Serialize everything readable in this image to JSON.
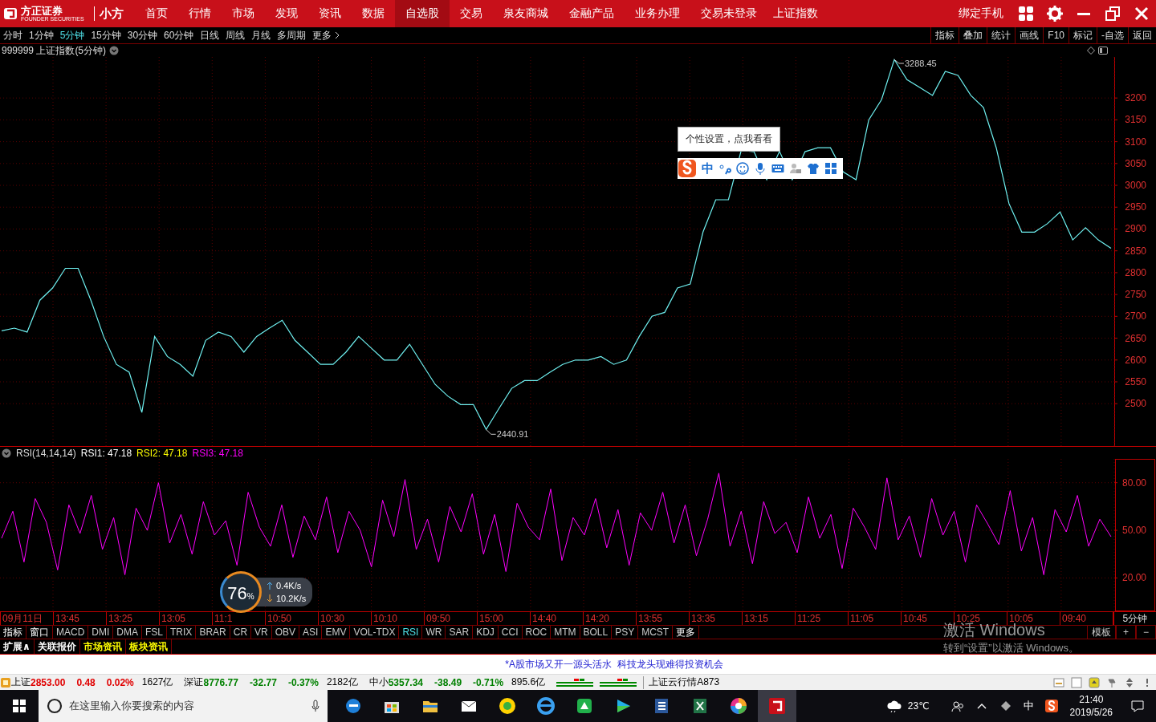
{
  "app_bar": {
    "logo": "方正证券",
    "logo_sub": "FOUNDER SECURITIES",
    "product": "小方",
    "nav": [
      {
        "label": "首页",
        "selected": false
      },
      {
        "label": "行情",
        "selected": false
      },
      {
        "label": "市场",
        "selected": false
      },
      {
        "label": "发现",
        "selected": false
      },
      {
        "label": "资讯",
        "selected": false
      },
      {
        "label": "数据",
        "selected": false
      },
      {
        "label": "自选股",
        "selected": true
      },
      {
        "label": "交易",
        "selected": false
      },
      {
        "label": "泉友商城",
        "selected": false
      },
      {
        "label": "金融产品",
        "selected": false
      },
      {
        "label": "业务办理",
        "selected": false
      }
    ],
    "trade_status": "交易未登录",
    "index_name": "上证指数",
    "bind_phone": "绑定手机"
  },
  "periods": [
    {
      "label": "分时",
      "selected": false
    },
    {
      "label": "1分钟",
      "selected": false
    },
    {
      "label": "5分钟",
      "selected": true
    },
    {
      "label": "15分钟",
      "selected": false
    },
    {
      "label": "30分钟",
      "selected": false
    },
    {
      "label": "60分钟",
      "selected": false
    },
    {
      "label": "日线",
      "selected": false
    },
    {
      "label": "周线",
      "selected": false
    },
    {
      "label": "月线",
      "selected": false
    },
    {
      "label": "多周期",
      "selected": false
    },
    {
      "label": "更多",
      "selected": false
    }
  ],
  "chart_tools": [
    "指标",
    "叠加",
    "统计",
    "画线",
    "F10",
    "标记",
    "-自选",
    "返回"
  ],
  "price_pane": {
    "title": "999999 上证指数(5分钟)",
    "chart_data": {
      "type": "line",
      "grid": true,
      "ylim": [
        2403,
        3294
      ],
      "yticks": [
        2500,
        2550,
        2600,
        2650,
        2700,
        2750,
        2800,
        2850,
        2900,
        2950,
        3000,
        3050,
        3100,
        3150,
        3200
      ],
      "series": [
        {
          "color": "#6ff0f0",
          "values": [
            2667,
            2673,
            2664,
            2737,
            2765,
            2810,
            2810,
            2737,
            2654,
            2590,
            2572,
            2480,
            2654,
            2608,
            2590,
            2563,
            2645,
            2664,
            2654,
            2618,
            2654,
            2673,
            2691,
            2645,
            2618,
            2590,
            2590,
            2618,
            2654,
            2627,
            2600,
            2600,
            2636,
            2590,
            2544,
            2517,
            2498,
            2498,
            2441,
            2489,
            2535,
            2553,
            2553,
            2572,
            2590,
            2600,
            2600,
            2608,
            2590,
            2600,
            2654,
            2700,
            2709,
            2765,
            2774,
            2893,
            2967,
            2967,
            3080,
            3077,
            3013,
            3078,
            3013,
            3077,
            3086,
            3086,
            3031,
            3013,
            3150,
            3196,
            3288,
            3242,
            3224,
            3206,
            3261,
            3252,
            3206,
            3178,
            3086,
            2958,
            2893,
            2893,
            2912,
            2939,
            2875,
            2903,
            2875,
            2856
          ]
        }
      ],
      "annotations": [
        "3288.45",
        "2440.91"
      ]
    }
  },
  "ime": {
    "tooltip": "个性设置，点我看看",
    "mode": "中"
  },
  "rsi_pane": {
    "title": "RSI(14,14,14)",
    "legend": [
      {
        "label": "RSI1: 47.18",
        "color": "#ffffff"
      },
      {
        "label": "RSI2: 47.18",
        "color": "#ffff00"
      },
      {
        "label": "RSI3: 47.18",
        "color": "#ff00ff"
      }
    ],
    "chart_data": {
      "type": "line",
      "grid": true,
      "ylim": [
        -1,
        95
      ],
      "yticks": [
        {
          "value": 20,
          "label": "20.00"
        },
        {
          "value": 50,
          "label": "50.00"
        },
        {
          "value": 80,
          "label": "80.00"
        }
      ],
      "series": [
        {
          "color": "#ff00ff",
          "values": [
            45,
            62,
            30,
            70,
            55,
            25,
            66,
            48,
            72,
            38,
            58,
            22,
            64,
            50,
            80,
            42,
            60,
            35,
            68,
            47,
            56,
            28,
            74,
            52,
            40,
            66,
            33,
            59,
            44,
            71,
            36,
            62,
            50,
            27,
            69,
            46,
            82,
            38,
            57,
            30,
            65,
            49,
            73,
            35,
            60,
            24,
            67,
            52,
            44,
            76,
            31,
            58,
            47,
            70,
            39,
            63,
            28,
            61,
            50,
            74,
            42,
            66,
            34,
            57,
            86,
            40,
            62,
            29,
            68,
            48,
            55,
            36,
            71,
            45,
            60,
            26,
            64,
            52,
            38,
            83,
            44,
            59,
            33,
            70,
            47,
            62,
            30,
            66,
            54,
            41,
            75,
            37,
            58,
            22,
            63,
            49,
            72,
            40,
            57,
            46
          ]
        }
      ]
    }
  },
  "speed_widget": {
    "percent": "76",
    "unit": "%",
    "upload": "0.4K/s",
    "download": "10.2K/s"
  },
  "time_axis": {
    "labels": [
      "09月11日",
      "13:45",
      "13:25",
      "13:05",
      "11:1",
      "10:50",
      "10:30",
      "10:10",
      "09:50",
      "15:00",
      "14:40",
      "14:20",
      "13:55",
      "13:35",
      "13:15",
      "11:25",
      "11:05",
      "10:45",
      "10:25",
      "10:05",
      "09:40"
    ],
    "period": "5分钟"
  },
  "indicator_tabs": [
    {
      "label": "指标",
      "kind": "menu",
      "selected": false
    },
    {
      "label": "窗口",
      "kind": "menu",
      "selected": false
    },
    {
      "label": "MACD",
      "kind": "indicator",
      "selected": false
    },
    {
      "label": "DMI",
      "kind": "indicator",
      "selected": false
    },
    {
      "label": "DMA",
      "kind": "indicator",
      "selected": false
    },
    {
      "label": "FSL",
      "kind": "indicator",
      "selected": false
    },
    {
      "label": "TRIX",
      "kind": "indicator",
      "selected": false
    },
    {
      "label": "BRAR",
      "kind": "indicator",
      "selected": false
    },
    {
      "label": "CR",
      "kind": "indicator",
      "selected": false
    },
    {
      "label": "VR",
      "kind": "indicator",
      "selected": false
    },
    {
      "label": "OBV",
      "kind": "indicator",
      "selected": false
    },
    {
      "label": "ASI",
      "kind": "indicator",
      "selected": false
    },
    {
      "label": "EMV",
      "kind": "indicator",
      "selected": false
    },
    {
      "label": "VOL-TDX",
      "kind": "indicator",
      "selected": false
    },
    {
      "label": "RSI",
      "kind": "indicator",
      "selected": true
    },
    {
      "label": "WR",
      "kind": "indicator",
      "selected": false
    },
    {
      "label": "SAR",
      "kind": "indicator",
      "selected": false
    },
    {
      "label": "KDJ",
      "kind": "indicator",
      "selected": false
    },
    {
      "label": "CCI",
      "kind": "indicator",
      "selected": false
    },
    {
      "label": "ROC",
      "kind": "indicator",
      "selected": false
    },
    {
      "label": "MTM",
      "kind": "indicator",
      "selected": false
    },
    {
      "label": "BOLL",
      "kind": "indicator",
      "selected": false
    },
    {
      "label": "PSY",
      "kind": "indicator",
      "selected": false
    },
    {
      "label": "MCST",
      "kind": "indicator",
      "selected": false
    },
    {
      "label": "更多",
      "kind": "menu",
      "selected": false
    }
  ],
  "template_controls": [
    "模板",
    "+",
    "−"
  ],
  "extension_tabs": [
    {
      "label": "扩展∧",
      "color": "#ffffff"
    },
    {
      "label": "关联报价",
      "color": "#ffffff"
    },
    {
      "label": "市场资讯",
      "color": "#ffff00"
    },
    {
      "label": "板块资讯",
      "color": "#ffff00"
    }
  ],
  "activation": {
    "title": "激活 Windows",
    "message": "转到“设置”以激活 Windows。"
  },
  "news_ticker": "*A股市场又开一源头活水  科技龙头现难得投资机会",
  "market_status": [
    {
      "name": "上证",
      "price": "2853.00",
      "change": "0.48",
      "percent": "0.02%",
      "turnover": "1627亿",
      "color": "#e00000"
    },
    {
      "name": "深证",
      "price": "8776.77",
      "change": "-32.77",
      "percent": "-0.37%",
      "turnover": "2182亿",
      "color": "#008000"
    },
    {
      "name": "中小",
      "price": "5357.34",
      "change": "-38.49",
      "percent": "-0.71%",
      "turnover": "895.6亿",
      "color": "#008000"
    }
  ],
  "cloud_quote": "上证云行情A873",
  "taskbar": {
    "search_placeholder": "在这里输入你要搜索的内容",
    "weather": "23℃",
    "ime": "中",
    "time": "21:40",
    "date": "2019/5/26"
  }
}
